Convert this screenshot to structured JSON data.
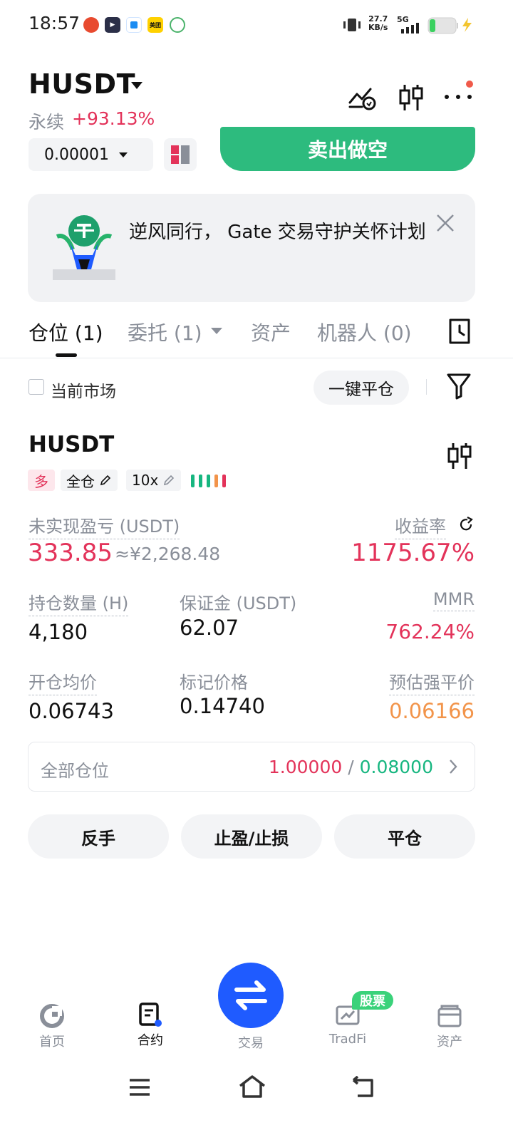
{
  "status_bar": {
    "time": "18:57",
    "net_speed_value": "27.7",
    "net_speed_unit": "KB/s",
    "network": "5G",
    "app_icons": [
      "app-red-icon",
      "app-video-icon",
      "app-blue-icon",
      "meituan-icon",
      "app-green-icon"
    ],
    "meituan_label": "美团"
  },
  "header": {
    "pair": "HUSDT",
    "contract_type": "永续",
    "change": "+93.13%",
    "precision": "0.00001",
    "sell_label": "卖出做空"
  },
  "banner": {
    "text": "逆风同行， Gate 交易守护关怀计划"
  },
  "tabs": [
    {
      "label": "仓位 (1)"
    },
    {
      "label": "委托 (1)"
    },
    {
      "label": "资产"
    },
    {
      "label": "机器人 (0)"
    }
  ],
  "filter": {
    "current_market": "当前市场",
    "close_all": "一键平仓"
  },
  "position": {
    "symbol": "HUSDT",
    "side": "多",
    "margin_mode": "全仓",
    "leverage": "10x",
    "unrealized_label": "未实现盈亏 (USDT)",
    "unrealized_value": "333.85",
    "unrealized_cny": "≈¥2,268.48",
    "roe_label": "收益率",
    "roe_value": "1175.67%",
    "qty_label": "持仓数量 (H)",
    "qty_value": "4,180",
    "margin_label": "保证金 (USDT)",
    "margin_value": "62.07",
    "mmr_label": "MMR",
    "mmr_value": "762.24%",
    "entry_label": "开仓均价",
    "entry_value": "0.06743",
    "mark_label": "标记价格",
    "mark_value": "0.14740",
    "liq_label": "预估强平价",
    "liq_value": "0.06166"
  },
  "all_positions": {
    "label": "全部仓位",
    "long_ratio": "1.00000",
    "separator": "/",
    "short_ratio": "0.08000"
  },
  "actions": {
    "reverse": "反手",
    "tp_sl": "止盈/止损",
    "close": "平仓"
  },
  "bottom_nav": {
    "home": "首页",
    "contract": "合约",
    "trade": "交易",
    "tradfi": "TradFi",
    "tradfi_badge": "股票",
    "assets": "资产"
  },
  "colors": {
    "sell": "#2dbb7e",
    "red": "#e3335a",
    "green": "#17b680",
    "orange": "#f2944a",
    "fab": "#1f5bff"
  }
}
